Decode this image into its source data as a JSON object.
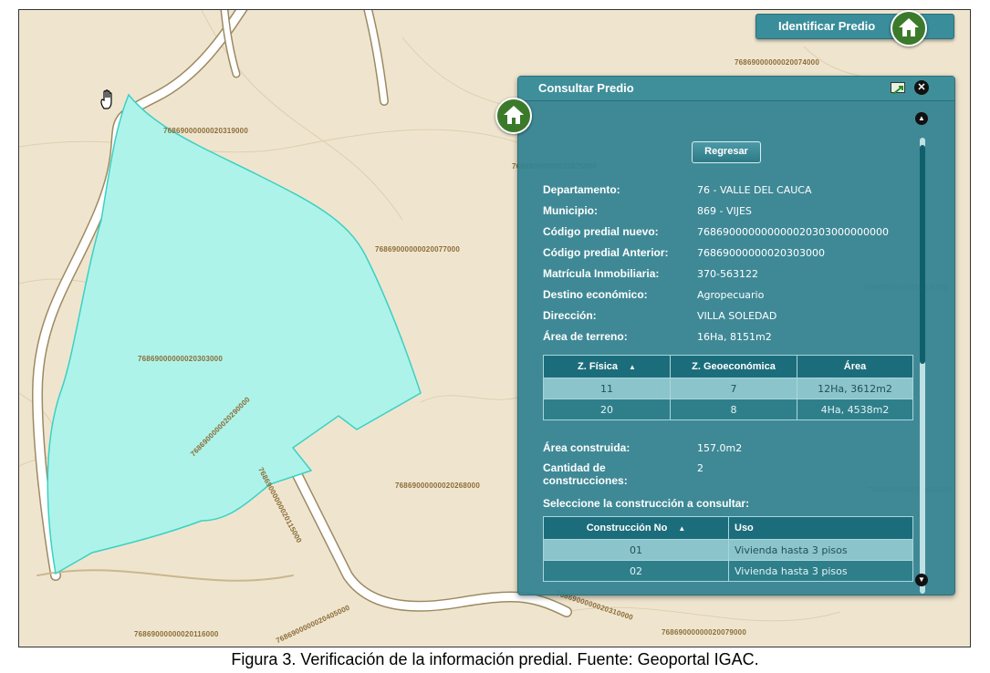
{
  "identify_button": {
    "label": "Identificar Predio"
  },
  "map": {
    "parcel_labels": [
      "76869000000020319000",
      "76869000000020077000",
      "76869000000020303000",
      "76869000000020268000",
      "76869000000020116000",
      "76869000000020074000",
      "76869000000020075000",
      "76869000000020079000",
      "7686900000020290000",
      "76869000000020115000",
      "7686900000020405000",
      "7686900000020310000",
      "76869000000020306200",
      "76869000000020342400"
    ]
  },
  "panel": {
    "title": "Consultar Predio",
    "back_button": "Regresar",
    "fields": [
      {
        "label": "Departamento:",
        "value": "76 - VALLE DEL CAUCA"
      },
      {
        "label": "Municipio:",
        "value": "869 - VIJES"
      },
      {
        "label": "Código predial nuevo:",
        "value": "768690000000000020303000000000"
      },
      {
        "label": "Código predial Anterior:",
        "value": "76869000000020303000"
      },
      {
        "label": "Matrícula Inmobiliaria:",
        "value": "370-563122"
      },
      {
        "label": "Destino económico:",
        "value": "Agropecuario"
      },
      {
        "label": "Dirección:",
        "value": "VILLA SOLEDAD"
      },
      {
        "label": "Área de terreno:",
        "value": "16Ha, 8151m2"
      }
    ],
    "zones_table": {
      "headers": [
        "Z. Física",
        "Z. Geoeconómica",
        "Área"
      ],
      "sort_glyph": "▲",
      "rows": [
        [
          "11",
          "7",
          "12Ha, 3612m2"
        ],
        [
          "20",
          "8",
          "4Ha, 4538m2"
        ]
      ]
    },
    "built_area": {
      "label": "Área construida:",
      "value": "157.0m2"
    },
    "constructions_count": {
      "label": "Cantidad de construcciones:",
      "value": "2"
    },
    "select_prompt": "Seleccione la construcción a consultar:",
    "constructions_table": {
      "headers": [
        "Construcción No",
        "Uso"
      ],
      "sort_glyph": "▲",
      "rows": [
        [
          "01",
          "Vivienda hasta 3 pisos"
        ],
        [
          "02",
          "Vivienda hasta 3 pisos"
        ]
      ]
    }
  },
  "caption": "Figura 3. Verificación de la información predial. Fuente: Geoportal IGAC.",
  "colors": {
    "parcel_fill": "#aef3e9",
    "panel_bg": "#32828f",
    "header_teal": "#1c6d7b",
    "home_green": "#3b7a2b"
  }
}
